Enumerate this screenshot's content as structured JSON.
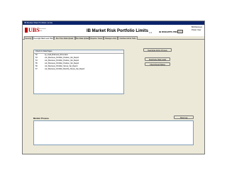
{
  "window": {
    "title": "IB Market Risk Portfolio Limits"
  },
  "header": {
    "logo_text": "UBS",
    "logo_sub": "Investment Bank",
    "title": "IB Market Risk Portfolio Limits",
    "version": "1.0",
    "env_label": "IB RISKAPPS PROD",
    "user_name": "Bill Robinson",
    "user_role": "Power User"
  },
  "tabs": [
    {
      "label": "Security"
    },
    {
      "label": "Overnight Batch and XML"
    },
    {
      "label": "Run Time Data Upload"
    },
    {
      "label": "Run Data Upload"
    },
    {
      "label": "Reports / Views"
    },
    {
      "label": "Manage Limits"
    },
    {
      "label": "Interface Admin Tools"
    }
  ],
  "list": {
    "header": "Check for Data Pages",
    "rows": [
      {
        "c1": "52",
        "c2": "sp_Load_Business_Dimension"
      },
      {
        "c1": "53",
        "c2": "Lim_Business_Portfolio_Position_Var_Report"
      },
      {
        "c1": "54",
        "c2": "Lim_Business_Portfolio_Position_Var_Report"
      },
      {
        "c1": "55",
        "c2": "Lim_Business_Portfolio_Position_Var_Report"
      },
      {
        "c1": "56",
        "c2": "Lim_Business_Portfolio_Stress_Var_Report"
      },
      {
        "c1": "57",
        "c2": "Lim_Business_Portfolio_Monthly_Stress_Var_Report"
      }
    ]
  },
  "buttons": {
    "action1": "Deactivate Entire Process",
    "action2": "Deactivate Data Loads",
    "action3": "Check Result Status",
    "clear_log": "Clear Log"
  },
  "messages": {
    "label": "Monitor Process",
    "content": ""
  }
}
